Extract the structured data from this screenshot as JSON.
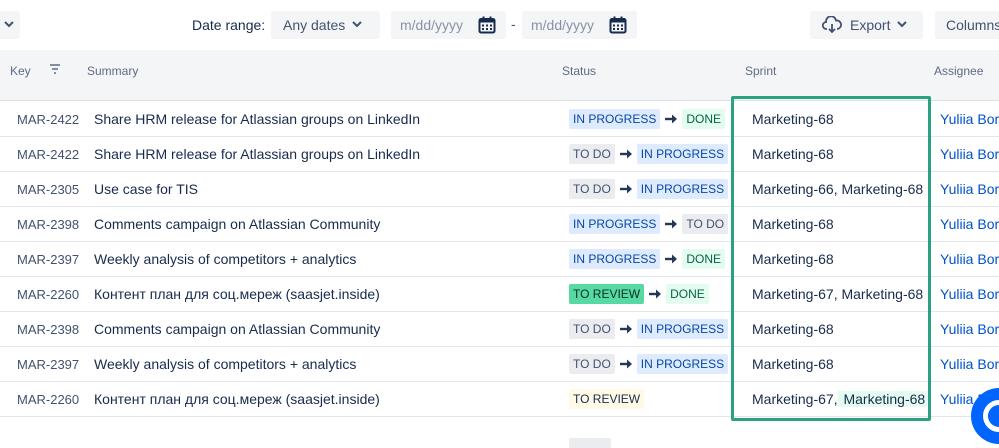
{
  "toolbar": {
    "date_range_label": "Date range:",
    "date_range_value": "Any dates",
    "from_placeholder": "m/dd/yyyy",
    "to_placeholder": "m/dd/yyyy",
    "separator": "-",
    "export_label": "Export",
    "columns_label": "Columns"
  },
  "table": {
    "headers": {
      "key": "Key",
      "summary": "Summary",
      "status": "Status",
      "sprint": "Sprint",
      "assignee": "Assignee"
    },
    "rows": [
      {
        "key": "MAR-2422",
        "summary": "Share HRM release for Atlassian groups on LinkedIn",
        "from": "IN PROGRESS",
        "to": "DONE",
        "sprint_a": "Marketing-68",
        "sprint_b": "",
        "assignee": "Yuliia Bori"
      },
      {
        "key": "MAR-2422",
        "summary": "Share HRM release for Atlassian groups on LinkedIn",
        "from": "TO DO",
        "to": "IN PROGRESS",
        "sprint_a": "Marketing-68",
        "sprint_b": "",
        "assignee": "Yuliia Bori"
      },
      {
        "key": "MAR-2305",
        "summary": "Use case for TIS",
        "from": "TO DO",
        "to": "IN PROGRESS",
        "sprint_a": "Marketing-66, Marketing-68",
        "sprint_b": "",
        "assignee": "Yuliia Bori"
      },
      {
        "key": "MAR-2398",
        "summary": "Comments campaign on Atlassian Community",
        "from": "IN PROGRESS",
        "to": "TO DO",
        "sprint_a": "Marketing-68",
        "sprint_b": "",
        "assignee": "Yuliia Bori"
      },
      {
        "key": "MAR-2397",
        "summary": "Weekly analysis of competitors + analytics",
        "from": "IN PROGRESS",
        "to": "DONE",
        "sprint_a": "Marketing-68",
        "sprint_b": "",
        "assignee": "Yuliia Bori"
      },
      {
        "key": "MAR-2260",
        "summary": "Контент план для соц.мереж (saasjet.inside)",
        "from": "TO REVIEW",
        "to": "DONE",
        "sprint_a": "Marketing-67, Marketing-68",
        "sprint_b": "",
        "assignee": "Yuliia Bori"
      },
      {
        "key": "MAR-2398",
        "summary": "Comments campaign on Atlassian Community",
        "from": "TO DO",
        "to": "IN PROGRESS",
        "sprint_a": "Marketing-68",
        "sprint_b": "",
        "assignee": "Yuliia Bori"
      },
      {
        "key": "MAR-2397",
        "summary": "Weekly analysis of competitors + analytics",
        "from": "TO DO",
        "to": "IN PROGRESS",
        "sprint_a": "Marketing-68",
        "sprint_b": "",
        "assignee": "Yuliia Bori"
      },
      {
        "key": "MAR-2260",
        "summary": "Контент план для соц.мереж (saasjet.inside)",
        "from": "TO REVIEW",
        "to": "",
        "sprint_a": "Marketing-67,",
        "sprint_b": " Marketing-68",
        "assignee": "Yuliia Bori"
      }
    ]
  },
  "colors": {
    "highlight_box": "#2aa181",
    "in_progress_bg": "#deebff",
    "done_bg": "#e3fcef",
    "todo_bg": "#ebecf0",
    "link": "#0052cc"
  },
  "icons": [
    "chevron-down-icon",
    "calendar-icon",
    "cloud-download-icon",
    "filter-icon",
    "arrow-right-icon",
    "help-icon"
  ]
}
